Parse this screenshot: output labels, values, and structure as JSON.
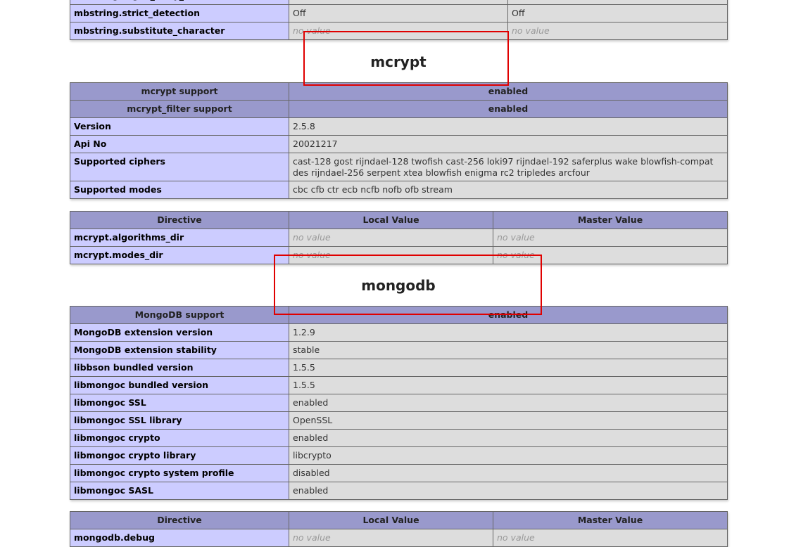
{
  "mbstring_tail": [
    {
      "name": "mbstring.strict_detection",
      "local": "Off",
      "master": "Off",
      "nv": false
    },
    {
      "name": "mbstring.substitute_character",
      "local": "no value",
      "master": "no value",
      "nv": true
    }
  ],
  "mcrypt": {
    "title": "mcrypt",
    "support": [
      {
        "name": "mcrypt support",
        "value": "enabled"
      },
      {
        "name": "mcrypt_filter support",
        "value": "enabled"
      }
    ],
    "info": [
      {
        "name": "Version",
        "value": "2.5.8"
      },
      {
        "name": "Api No",
        "value": "20021217"
      },
      {
        "name": "Supported ciphers",
        "value": "cast-128 gost rijndael-128 twofish cast-256 loki97 rijndael-192 saferplus wake blowfish-compat des rijndael-256 serpent xtea blowfish enigma rc2 tripledes arcfour"
      },
      {
        "name": "Supported modes",
        "value": "cbc cfb ctr ecb ncfb nofb ofb stream"
      }
    ],
    "directives": [
      {
        "name": "mcrypt.algorithms_dir",
        "local": "no value",
        "master": "no value"
      },
      {
        "name": "mcrypt.modes_dir",
        "local": "no value",
        "master": "no value"
      }
    ]
  },
  "mongodb": {
    "title": "mongodb",
    "support": {
      "name": "MongoDB support",
      "value": "enabled"
    },
    "info": [
      {
        "name": "MongoDB extension version",
        "value": "1.2.9"
      },
      {
        "name": "MongoDB extension stability",
        "value": "stable"
      },
      {
        "name": "libbson bundled version",
        "value": "1.5.5"
      },
      {
        "name": "libmongoc bundled version",
        "value": "1.5.5"
      },
      {
        "name": "libmongoc SSL",
        "value": "enabled"
      },
      {
        "name": "libmongoc SSL library",
        "value": "OpenSSL"
      },
      {
        "name": "libmongoc crypto",
        "value": "enabled"
      },
      {
        "name": "libmongoc crypto library",
        "value": "libcrypto"
      },
      {
        "name": "libmongoc crypto system profile",
        "value": "disabled"
      },
      {
        "name": "libmongoc SASL",
        "value": "enabled"
      }
    ],
    "directives": [
      {
        "name": "mongodb.debug",
        "local": "no value",
        "master": "no value"
      }
    ]
  },
  "headers": {
    "directive": "Directive",
    "local": "Local Value",
    "master": "Master Value"
  },
  "colors": {
    "header": "#9999cc",
    "label": "#ccccff",
    "value": "#dddddd",
    "highlight": "#e00000"
  }
}
